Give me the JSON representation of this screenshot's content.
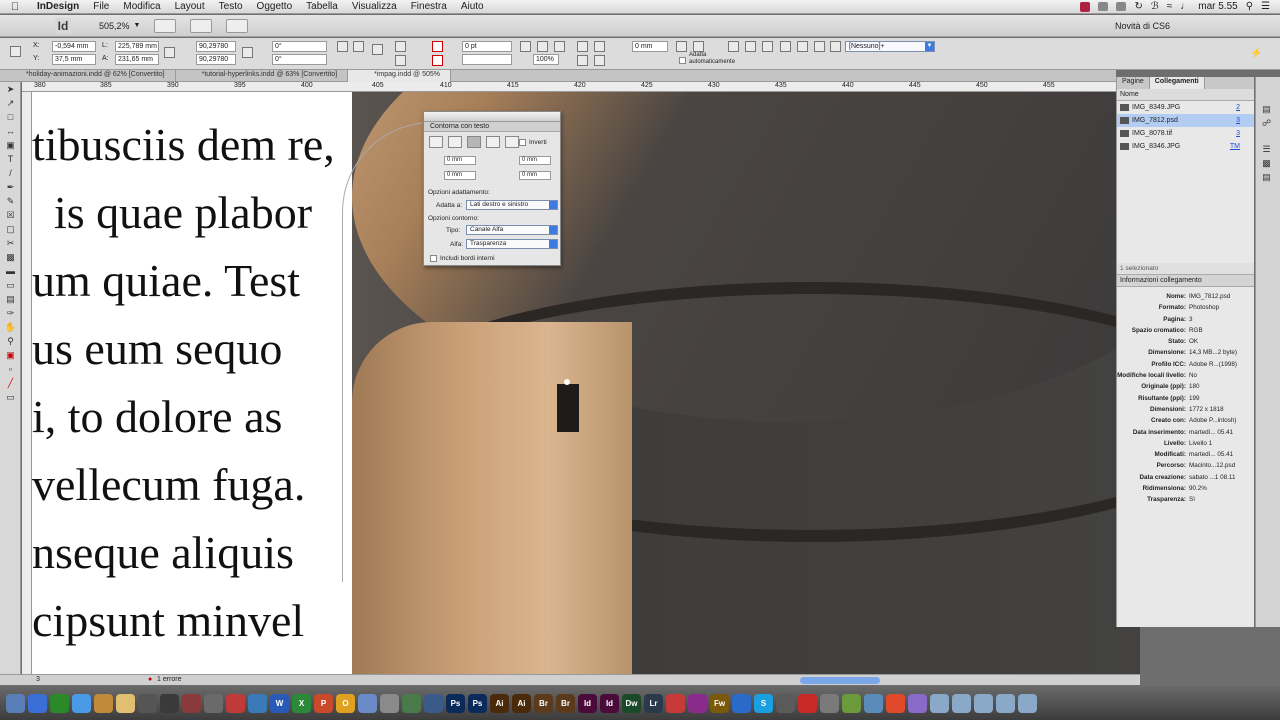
{
  "menubar": {
    "app_name": "InDesign",
    "items": [
      "File",
      "Modifica",
      "Layout",
      "Testo",
      "Oggetto",
      "Tabella",
      "Visualizza",
      "Finestra",
      "Aiuto"
    ],
    "clock": "mar 5.55"
  },
  "appbar": {
    "logo": "Id",
    "zoom": "505,2%",
    "novita": "Novità di CS6"
  },
  "control": {
    "x": "-0,594 mm",
    "y": "37,5 mm",
    "l": "225,789 mm",
    "a": "231,65 mm",
    "scale_x": "90,29780",
    "scale_y": "90,29780",
    "angle": "0°",
    "shear": "0°",
    "stroke_weight": "0 pt",
    "zoom_pct": "100%",
    "offset": "0 mm",
    "adatta": "Adatta automaticamente",
    "style_dropdown": "[Nessuno]+"
  },
  "tabs": [
    "*holiday-animazioni.indd @ 62% [Convertito]",
    "*tutorial-hyperlinks.indd @ 63% [Convertito]",
    "*impag.indd @ 505%"
  ],
  "ruler": [
    "380",
    "385",
    "390",
    "395",
    "400",
    "405",
    "410",
    "415",
    "420",
    "425",
    "430",
    "435",
    "440",
    "445",
    "450",
    "455"
  ],
  "document_text": [
    "tibusciis dem re,",
    "is quae plabor",
    "um quiae. Test",
    "us eum sequo",
    "i, to dolore as",
    "vellecum fuga.",
    "nseque aliquis",
    "cipsunt minvel"
  ],
  "wrap_panel": {
    "title": "Contorna con testo",
    "invert": "Inverti",
    "top_offset": "0 mm",
    "bottom_offset": "0 mm",
    "left_offset": "0 mm",
    "right_offset": "0 mm",
    "wrap_options_title": "Opzioni adattamento:",
    "wrap_to_label": "Adatta a:",
    "wrap_to_value": "Lati destro e sinistro",
    "contour_title": "Opzioni contorno:",
    "type_label": "Tipo:",
    "type_value": "Canale Alfa",
    "alpha_label": "Alfa:",
    "alpha_value": "Trasparenza",
    "include_inside": "Includi bordi interni"
  },
  "right_panel": {
    "tabs": [
      "Pagine",
      "Collegamenti"
    ],
    "column": "Nome",
    "links": [
      {
        "name": "IMG_8349.JPG",
        "page": "2"
      },
      {
        "name": "IMG_7812.psd",
        "page": "3"
      },
      {
        "name": "IMG_8078.tif",
        "page": "3"
      },
      {
        "name": "IMG_8346.JPG",
        "page": "TM"
      }
    ],
    "selected_count": "1 selezionato",
    "info_title": "Informazioni collegamento",
    "info": [
      {
        "k": "Nome:",
        "v": "IMG_7812.psd"
      },
      {
        "k": "Formato:",
        "v": "Photoshop"
      },
      {
        "k": "Pagina:",
        "v": "3"
      },
      {
        "k": "Spazio cromatico:",
        "v": "RGB"
      },
      {
        "k": "Stato:",
        "v": "OK"
      },
      {
        "k": "Dimensione:",
        "v": "14,3 MB...2 byte)"
      },
      {
        "k": "Profilo ICC:",
        "v": "Adobe R...(1998)"
      },
      {
        "k": "Modifiche locali livello:",
        "v": "No"
      },
      {
        "k": "Originale (ppi):",
        "v": "180"
      },
      {
        "k": "Risultante (ppi):",
        "v": "199"
      },
      {
        "k": "Dimensioni:",
        "v": "1772 x 1818"
      },
      {
        "k": "Creato con:",
        "v": "Adobe P...intosh)"
      },
      {
        "k": "Data inserimento:",
        "v": "martedì... 05.41"
      },
      {
        "k": "Livello:",
        "v": "Livello 1"
      },
      {
        "k": "Modificati:",
        "v": "martedì... 05.41"
      },
      {
        "k": "Percorso:",
        "v": "Macinto...12.psd"
      },
      {
        "k": "Data creazione:",
        "v": "sabato ...1 08.11"
      },
      {
        "k": "Ridimensiona:",
        "v": "90.2%"
      },
      {
        "k": "Trasparenza:",
        "v": "Sì"
      }
    ]
  },
  "status": {
    "page": "3",
    "errors": "1 errore"
  },
  "dock_icons": [
    {
      "label": "",
      "color": "#5a7fb8"
    },
    {
      "label": "",
      "color": "#3a6fd8"
    },
    {
      "label": "",
      "color": "#2a8a2a"
    },
    {
      "label": "",
      "color": "#4a9ae8"
    },
    {
      "label": "",
      "color": "#c08a3a"
    },
    {
      "label": "",
      "color": "#e0c070"
    },
    {
      "label": "",
      "color": "#555555"
    },
    {
      "label": "",
      "color": "#3a3a3a"
    },
    {
      "label": "",
      "color": "#8a3a3a"
    },
    {
      "label": "",
      "color": "#6a6a6a"
    },
    {
      "label": "",
      "color": "#c03a3a"
    },
    {
      "label": "",
      "color": "#3a7ab8"
    },
    {
      "label": "W",
      "color": "#2a5ab8"
    },
    {
      "label": "X",
      "color": "#2a8a3a"
    },
    {
      "label": "P",
      "color": "#c84a2a"
    },
    {
      "label": "O",
      "color": "#e0a020"
    },
    {
      "label": "",
      "color": "#6a8ac8"
    },
    {
      "label": "",
      "color": "#8a8a8a"
    },
    {
      "label": "",
      "color": "#4a7a4a"
    },
    {
      "label": "",
      "color": "#3a5a8a"
    },
    {
      "label": "Ps",
      "color": "#0a2a5a"
    },
    {
      "label": "Ps",
      "color": "#0a2a5a"
    },
    {
      "label": "Ai",
      "color": "#4a2a0a"
    },
    {
      "label": "Ai",
      "color": "#4a2a0a"
    },
    {
      "label": "Br",
      "color": "#5a3a1a"
    },
    {
      "label": "Br",
      "color": "#5a3a1a"
    },
    {
      "label": "Id",
      "color": "#4a0a3a"
    },
    {
      "label": "Id",
      "color": "#4a0a3a"
    },
    {
      "label": "Dw",
      "color": "#1a4a2a"
    },
    {
      "label": "Lr",
      "color": "#2a3a4a"
    },
    {
      "label": "",
      "color": "#c83a3a"
    },
    {
      "label": "",
      "color": "#8a2a8a"
    },
    {
      "label": "Fw",
      "color": "#7a5a0a"
    },
    {
      "label": "",
      "color": "#2a6ac8"
    },
    {
      "label": "S",
      "color": "#1aa0e0"
    },
    {
      "label": "",
      "color": "#5a5a5a"
    },
    {
      "label": "",
      "color": "#c82a2a"
    },
    {
      "label": "",
      "color": "#7a7a7a"
    },
    {
      "label": "",
      "color": "#6a9a3a"
    },
    {
      "label": "",
      "color": "#5a8ab8"
    },
    {
      "label": "",
      "color": "#e04a2a"
    },
    {
      "label": "",
      "color": "#8a6ac8"
    },
    {
      "label": "",
      "color": "#8aa8c8"
    },
    {
      "label": "",
      "color": "#8aa8c8"
    },
    {
      "label": "",
      "color": "#8aa8c8"
    },
    {
      "label": "",
      "color": "#8aa8c8"
    },
    {
      "label": "",
      "color": "#8aa8c8"
    }
  ]
}
